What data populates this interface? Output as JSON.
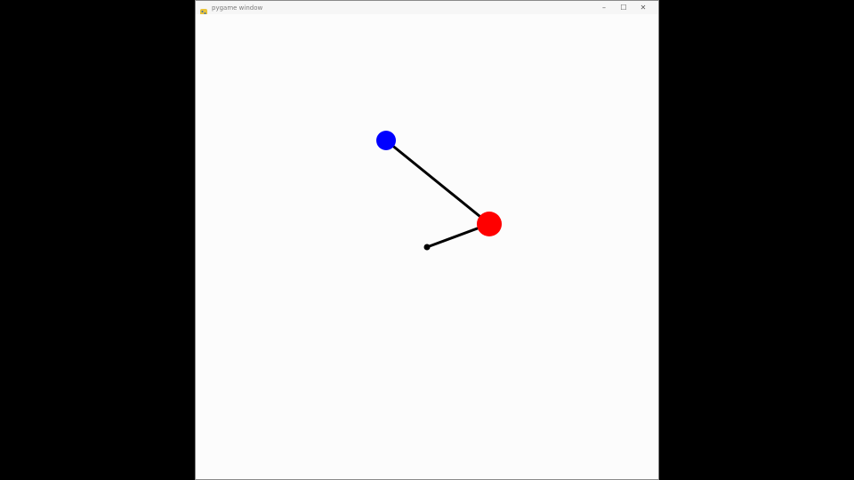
{
  "window": {
    "title": "pygame window",
    "controls": {
      "minimize_glyph": "–",
      "maximize_glyph": "☐",
      "close_glyph": "✕"
    }
  },
  "scene": {
    "background_color": "#fcfcfc",
    "rod_color": "#000000",
    "bob_blue_color": "#0000ff",
    "bob_red_color": "#ff0000"
  }
}
